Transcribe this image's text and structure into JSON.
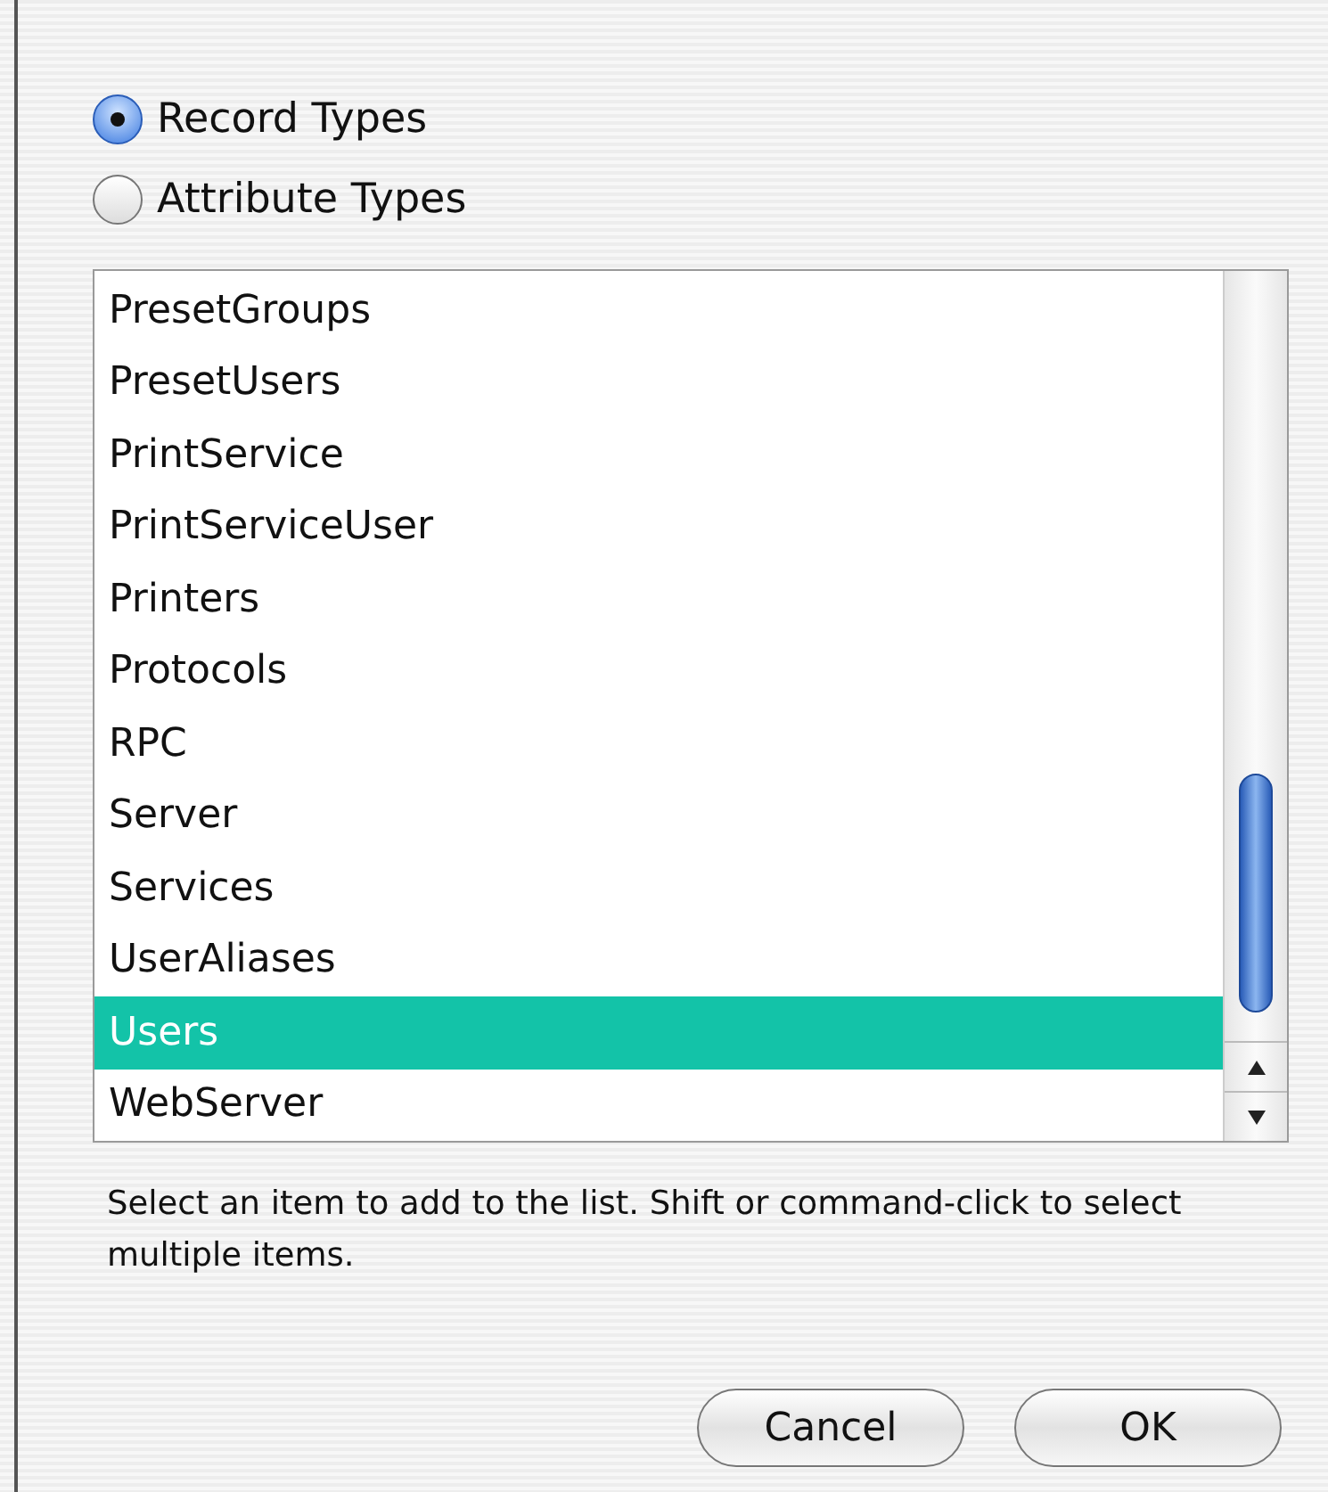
{
  "options": [
    {
      "label": "Record Types",
      "selected": true
    },
    {
      "label": "Attribute Types",
      "selected": false
    }
  ],
  "list": {
    "items": [
      {
        "label": "PresetGroups",
        "selected": false
      },
      {
        "label": "PresetUsers",
        "selected": false
      },
      {
        "label": "PrintService",
        "selected": false
      },
      {
        "label": "PrintServiceUser",
        "selected": false
      },
      {
        "label": "Printers",
        "selected": false
      },
      {
        "label": "Protocols",
        "selected": false
      },
      {
        "label": "RPC",
        "selected": false
      },
      {
        "label": "Server",
        "selected": false
      },
      {
        "label": "Services",
        "selected": false
      },
      {
        "label": "UserAliases",
        "selected": false
      },
      {
        "label": "Users",
        "selected": true
      },
      {
        "label": "WebServer",
        "selected": false
      }
    ]
  },
  "help_text": "Select an item to add to the list. Shift or command-click to select multiple items.",
  "buttons": [
    "Cancel",
    "OK"
  ]
}
